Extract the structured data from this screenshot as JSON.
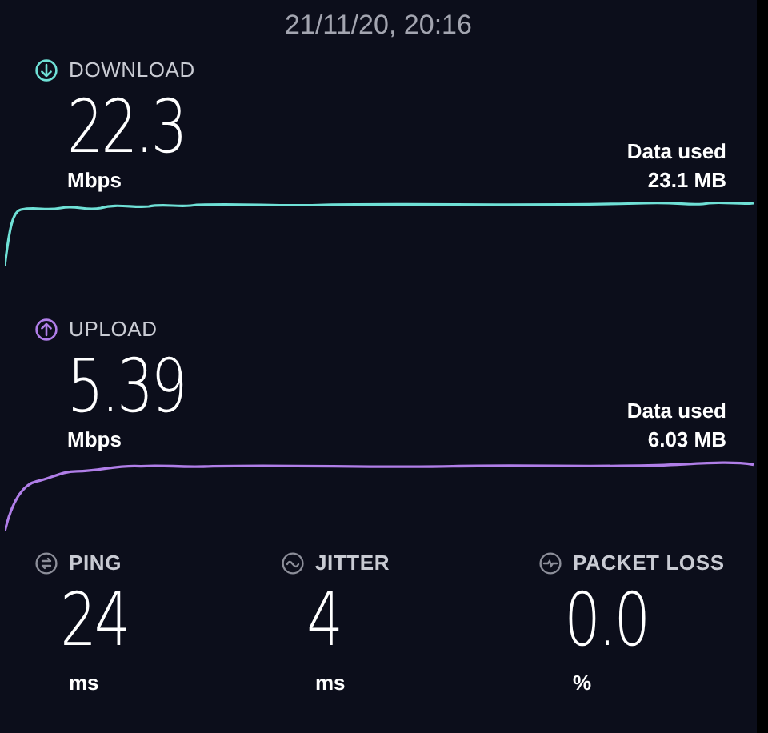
{
  "timestamp": "21/11/20, 20:16",
  "tests": [
    {
      "kind": "download",
      "label": "DOWNLOAD",
      "value": "22.3",
      "unit": "Mbps",
      "data_label": "Data used",
      "data_value": "23.1 MB",
      "color": "#6fe0d6"
    },
    {
      "kind": "upload",
      "label": "UPLOAD",
      "value": "5.39",
      "unit": "Mbps",
      "data_label": "Data used",
      "data_value": "6.03 MB",
      "color": "#b07ee8"
    }
  ],
  "stats": [
    {
      "kind": "ping",
      "label": "PING",
      "value": "24",
      "unit": "ms"
    },
    {
      "kind": "jitter",
      "label": "JITTER",
      "value": "4",
      "unit": "ms"
    },
    {
      "kind": "packet_loss",
      "label": "PACKET LOSS",
      "value": "0.0",
      "unit": "%"
    }
  ]
}
